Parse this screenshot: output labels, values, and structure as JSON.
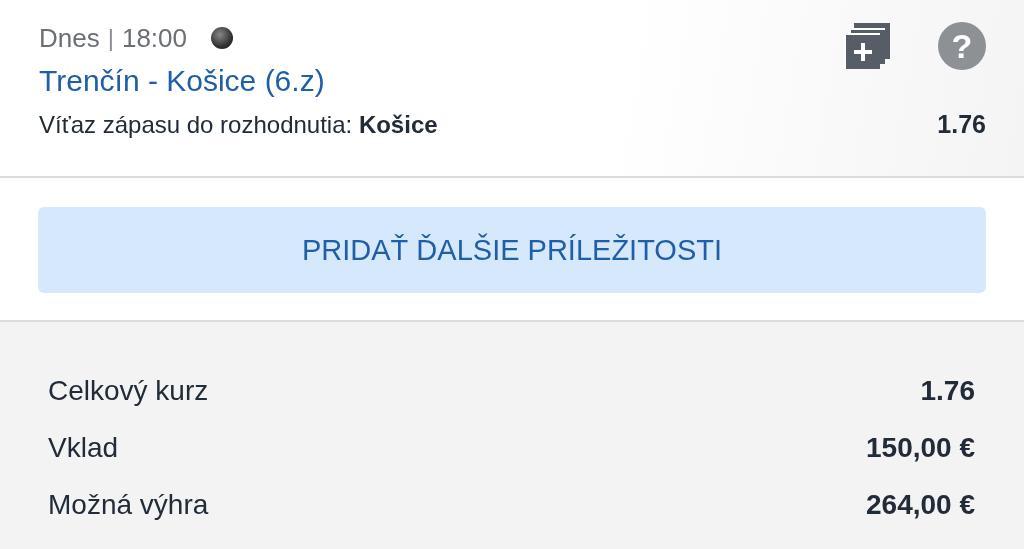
{
  "bet": {
    "day": "Dnes",
    "separator": "|",
    "time": "18:00",
    "title": "Trenčín - Košice (6.z)",
    "market": "Víťaz zápasu do rozhodnutia: **Košice**",
    "odds": "1.76",
    "help": "?"
  },
  "add_button": {
    "label": "PRIDAŤ ĎALŠIE PRÍLEŽITOSTI"
  },
  "summary": [
    {
      "label": "Celkový kurz",
      "value": "1.76"
    },
    {
      "label": "Vklad",
      "value": "150,00 €"
    },
    {
      "label": "Možná výhra",
      "value": "264,00 €"
    }
  ]
}
